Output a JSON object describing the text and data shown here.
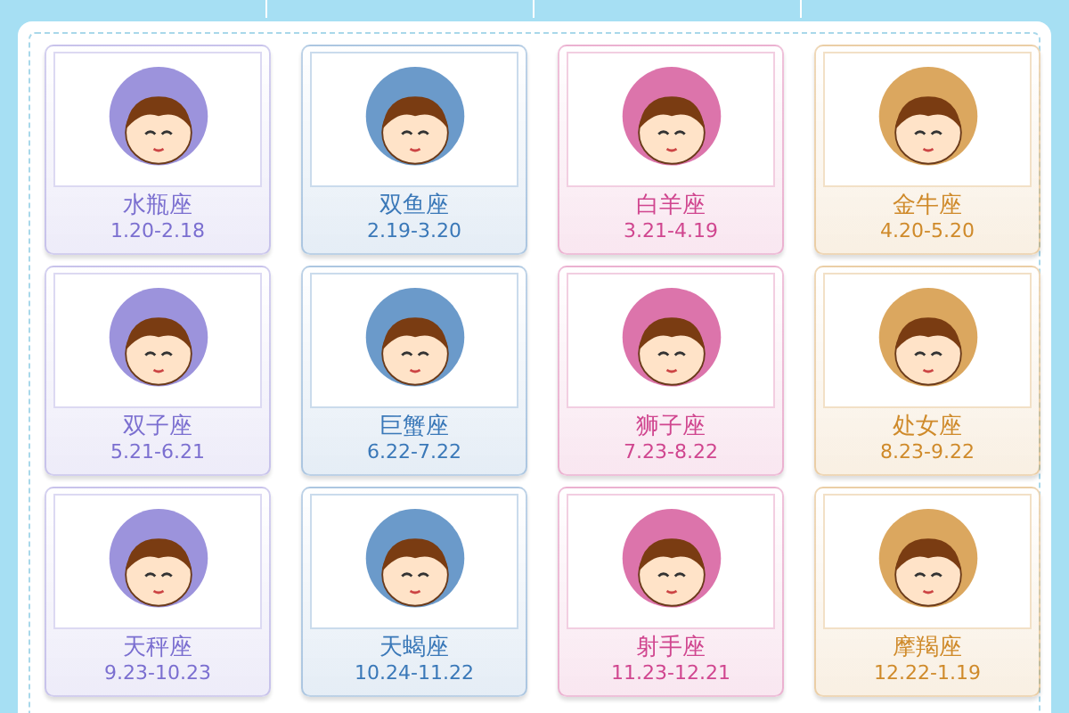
{
  "signs": [
    {
      "name": "水瓶座",
      "dates": "1.20-2.18",
      "color": "#7b6fd0"
    },
    {
      "name": "双鱼座",
      "dates": "2.19-3.20",
      "color": "#3a78b8"
    },
    {
      "name": "白羊座",
      "dates": "3.21-4.19",
      "color": "#d0468f"
    },
    {
      "name": "金牛座",
      "dates": "4.20-5.20",
      "color": "#cf8a2a"
    },
    {
      "name": "双子座",
      "dates": "5.21-6.21",
      "color": "#7b6fd0"
    },
    {
      "name": "巨蟹座",
      "dates": "6.22-7.22",
      "color": "#3a78b8"
    },
    {
      "name": "狮子座",
      "dates": "7.23-8.22",
      "color": "#d0468f"
    },
    {
      "name": "处女座",
      "dates": "8.23-9.22",
      "color": "#cf8a2a"
    },
    {
      "name": "天秤座",
      "dates": "9.23-10.23",
      "color": "#7b6fd0"
    },
    {
      "name": "天蝎座",
      "dates": "10.24-11.22",
      "color": "#3a78b8"
    },
    {
      "name": "射手座",
      "dates": "11.23-12.21",
      "color": "#d0468f"
    },
    {
      "name": "摩羯座",
      "dates": "12.22-1.19",
      "color": "#cf8a2a"
    }
  ]
}
